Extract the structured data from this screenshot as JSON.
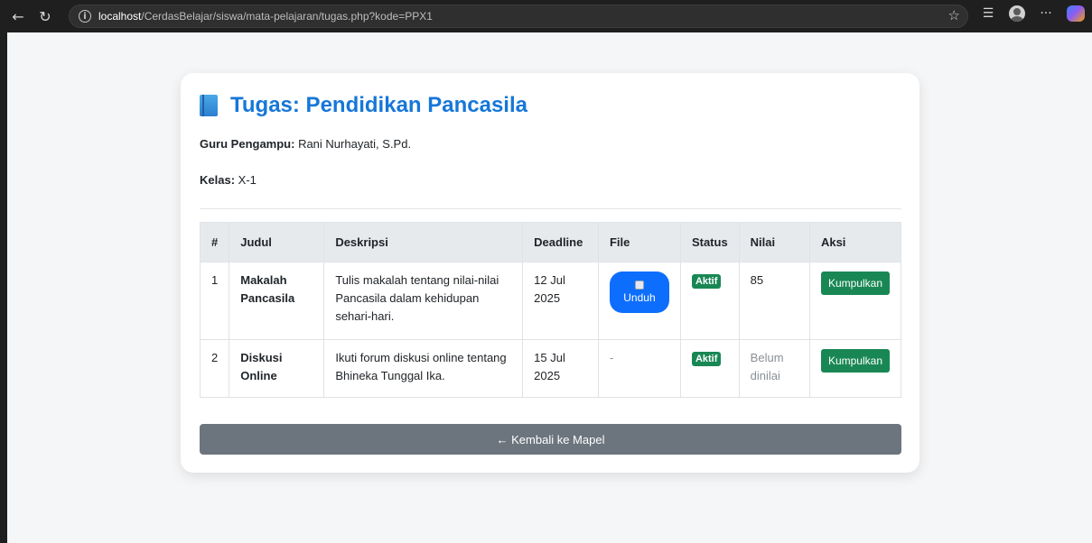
{
  "browser": {
    "url_host": "localhost",
    "url_path": "/CerdasBelajar/siswa/mata-pelajaran/tugas.php?kode=PPX1"
  },
  "page": {
    "title": "Tugas: Pendidikan Pancasila",
    "guru_label": "Guru Pengampu:",
    "guru_value": " Rani Nurhayati, S.Pd.",
    "kelas_label": "Kelas:",
    "kelas_value": " X-1"
  },
  "table": {
    "headers": [
      "#",
      "Judul",
      "Deskripsi",
      "Deadline",
      "File",
      "Status",
      "Nilai",
      "Aksi"
    ],
    "rows": [
      {
        "no": "1",
        "judul": "Makalah Pancasila",
        "deskripsi": "Tulis makalah tentang nilai-nilai Pancasila dalam kehidupan sehari-hari.",
        "deadline": "12 Jul 2025",
        "file": "Unduh",
        "status": "Aktif",
        "nilai": "85",
        "aksi": "Kumpulkan"
      },
      {
        "no": "2",
        "judul": "Diskusi Online",
        "deskripsi": "Ikuti forum diskusi online tentang Bhineka Tunggal Ika.",
        "deadline": "15 Jul 2025",
        "file": "-",
        "status": "Aktif",
        "nilai": "Belum dinilai",
        "aksi": "Kumpulkan"
      }
    ]
  },
  "back_button": "← Kembali ke Mapel",
  "colors": {
    "title": "#1677d8",
    "primary": "#0d6efd",
    "success": "#198754",
    "secondary": "#6c757d"
  }
}
